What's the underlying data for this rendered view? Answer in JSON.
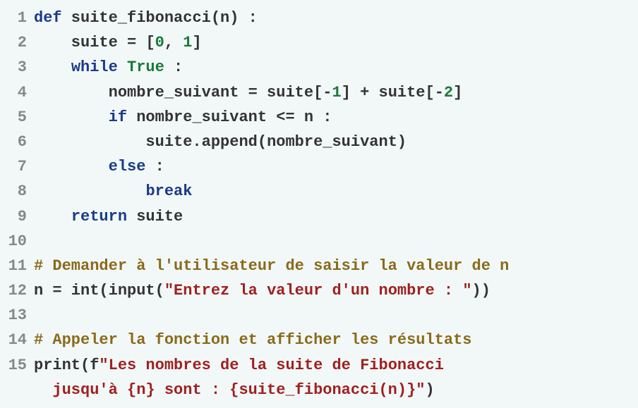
{
  "code": {
    "lines": [
      {
        "n": "1",
        "tokens": [
          [
            "kw",
            "def"
          ],
          [
            "ident",
            " suite_fibonacci"
          ],
          [
            "paren",
            "("
          ],
          [
            "ident",
            "n"
          ],
          [
            "paren",
            ")"
          ],
          [
            "op",
            " :"
          ]
        ]
      },
      {
        "n": "2",
        "tokens": [
          [
            "ident",
            "    suite "
          ],
          [
            "op",
            "="
          ],
          [
            "ident",
            " "
          ],
          [
            "paren",
            "["
          ],
          [
            "num",
            "0"
          ],
          [
            "op",
            ", "
          ],
          [
            "num",
            "1"
          ],
          [
            "paren",
            "]"
          ]
        ]
      },
      {
        "n": "3",
        "tokens": [
          [
            "ident",
            "    "
          ],
          [
            "kw",
            "while"
          ],
          [
            "ident",
            " "
          ],
          [
            "bool",
            "True"
          ],
          [
            "op",
            " :"
          ]
        ]
      },
      {
        "n": "4",
        "tokens": [
          [
            "ident",
            "        nombre_suivant "
          ],
          [
            "op",
            "="
          ],
          [
            "ident",
            " suite"
          ],
          [
            "paren",
            "["
          ],
          [
            "op",
            "-"
          ],
          [
            "num",
            "1"
          ],
          [
            "paren",
            "]"
          ],
          [
            "op",
            " + "
          ],
          [
            "ident",
            "suite"
          ],
          [
            "paren",
            "["
          ],
          [
            "op",
            "-"
          ],
          [
            "num",
            "2"
          ],
          [
            "paren",
            "]"
          ]
        ]
      },
      {
        "n": "5",
        "tokens": [
          [
            "ident",
            "        "
          ],
          [
            "kw",
            "if"
          ],
          [
            "ident",
            " nombre_suivant "
          ],
          [
            "op",
            "<="
          ],
          [
            "ident",
            " n "
          ],
          [
            "op",
            ":"
          ]
        ]
      },
      {
        "n": "6",
        "tokens": [
          [
            "ident",
            "            suite.append"
          ],
          [
            "paren",
            "("
          ],
          [
            "ident",
            "nombre_suivant"
          ],
          [
            "paren",
            ")"
          ]
        ]
      },
      {
        "n": "7",
        "tokens": [
          [
            "ident",
            "        "
          ],
          [
            "kw",
            "else"
          ],
          [
            "op",
            " :"
          ]
        ]
      },
      {
        "n": "8",
        "tokens": [
          [
            "ident",
            "            "
          ],
          [
            "kw",
            "break"
          ]
        ]
      },
      {
        "n": "9",
        "tokens": [
          [
            "ident",
            "    "
          ],
          [
            "kw",
            "return"
          ],
          [
            "ident",
            " suite"
          ]
        ]
      },
      {
        "n": "10",
        "tokens": []
      },
      {
        "n": "11",
        "tokens": [
          [
            "comment",
            "# Demander à l'utilisateur de saisir la valeur de n"
          ]
        ]
      },
      {
        "n": "12",
        "tokens": [
          [
            "ident",
            "n "
          ],
          [
            "op",
            "="
          ],
          [
            "ident",
            " int"
          ],
          [
            "paren",
            "("
          ],
          [
            "ident",
            "input"
          ],
          [
            "paren",
            "("
          ],
          [
            "str",
            "\"Entrez la valeur d'un nombre : \""
          ],
          [
            "paren",
            "))"
          ]
        ]
      },
      {
        "n": "13",
        "tokens": []
      },
      {
        "n": "14",
        "tokens": [
          [
            "comment",
            "# Appeler la fonction et afficher les résultats"
          ]
        ]
      },
      {
        "n": "15",
        "tokens": [
          [
            "ident",
            "print"
          ],
          [
            "paren",
            "("
          ],
          [
            "ident",
            "f"
          ],
          [
            "str",
            "\"Les nombres de la suite de Fibonacci"
          ]
        ]
      },
      {
        "n": "",
        "tokens": [
          [
            "str",
            "  jusqu'à {n} sont : {suite_fibonacci(n)}\""
          ],
          [
            "paren",
            ")"
          ]
        ]
      }
    ]
  }
}
